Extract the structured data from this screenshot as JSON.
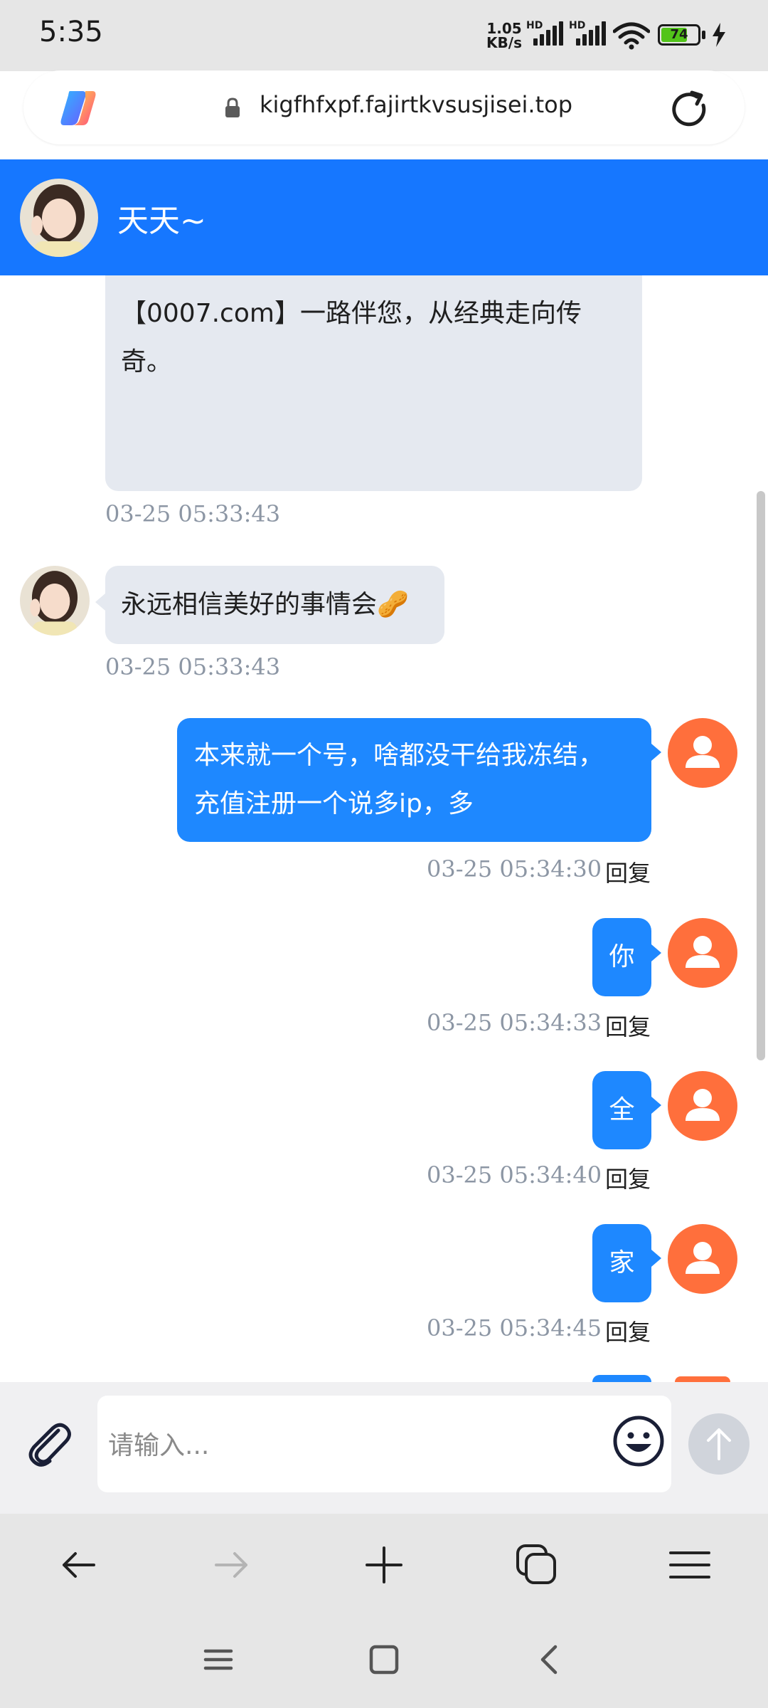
{
  "status_bar": {
    "time": "5:35",
    "net_speed_value": "1.05",
    "net_speed_unit": "KB/s",
    "sim1_label": "HD",
    "sim2_label": "HD",
    "battery_percent": "74",
    "battery_level": 0.74,
    "charging": true
  },
  "browser": {
    "url": "kigfhfxpf.fajirtkvsusjisei.top",
    "logo_icon": "copilot-logo-icon",
    "reload_icon": "reload-icon"
  },
  "chat": {
    "contact_name": "天天~",
    "messages": [
      {
        "dir": "in",
        "lines": [
          "【0007.com】一路伴您，从经典走向传",
          "奇。"
        ],
        "time": "03-25 05:33:43"
      },
      {
        "dir": "in",
        "lines": [
          "永远相信美好的事情会🥜"
        ],
        "time": "03-25 05:33:43"
      },
      {
        "dir": "out",
        "lines": [
          "本来就一个号，啥都没干给我冻结，",
          "充值注册一个说多ip，多"
        ],
        "time": "03-25 05:34:30",
        "reply": "回复"
      },
      {
        "dir": "out",
        "lines": [
          "你"
        ],
        "time": "03-25 05:34:33",
        "reply": "回复"
      },
      {
        "dir": "out",
        "lines": [
          "全"
        ],
        "time": "03-25 05:34:40",
        "reply": "回复"
      },
      {
        "dir": "out",
        "lines": [
          "家"
        ],
        "time": "03-25 05:34:45",
        "reply": "回复"
      }
    ]
  },
  "composer": {
    "placeholder": "请输入...",
    "attach_icon": "paperclip-icon",
    "emoji_icon": "smiley-icon",
    "send_icon": "arrow-up-icon"
  },
  "colors": {
    "header_blue": "#1677ff",
    "outgoing_bubble": "#1e88ff",
    "incoming_bubble": "#e5e9f0",
    "user_avatar": "#ff6f3c",
    "timestamp": "#8c96a4"
  }
}
